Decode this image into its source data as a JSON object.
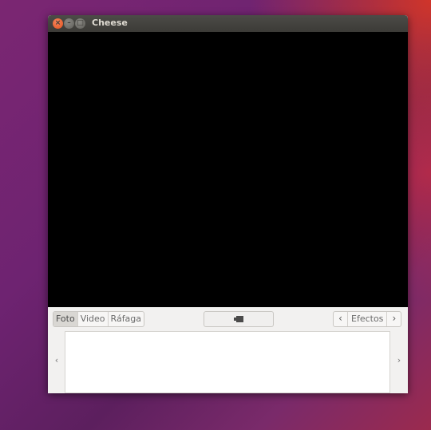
{
  "window": {
    "title": "Cheese",
    "controls": {
      "close": "×",
      "minimize": "–",
      "maximize": "□"
    }
  },
  "toolbar": {
    "modes": [
      {
        "label": "Foto",
        "active": true
      },
      {
        "label": "Video",
        "active": false
      },
      {
        "label": "Ráfaga",
        "active": false
      }
    ],
    "shoot_icon": "camera-take-photo-icon",
    "effects": {
      "prev": "‹",
      "label": "Efectos",
      "next": "›"
    }
  },
  "thumbnails": {
    "prev": "‹",
    "next": "›"
  }
}
